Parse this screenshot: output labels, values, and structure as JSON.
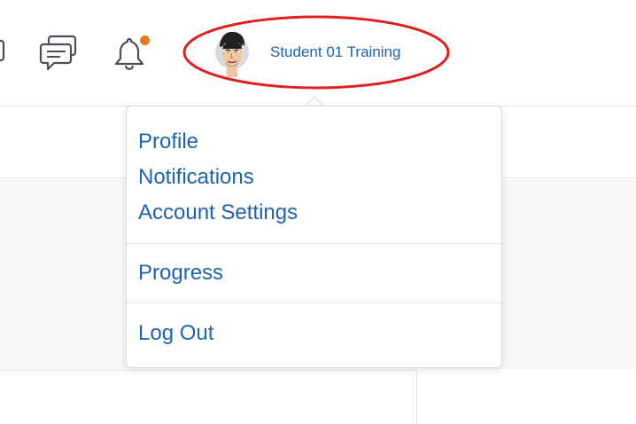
{
  "header": {
    "accent_color": "#2d6fb7",
    "icons": [
      "partial-icon",
      "chat-icon",
      "bell-icon"
    ],
    "notification_dot_color": "#e87722"
  },
  "user": {
    "name": "Student 01 Training",
    "avatar": "cartoon-face-avatar",
    "highlight_color": "#e02020"
  },
  "user_menu": {
    "items": [
      {
        "label": "Profile"
      },
      {
        "label": "Notifications"
      },
      {
        "label": "Account Settings"
      },
      {
        "label": "Progress"
      },
      {
        "label": "Log Out"
      }
    ],
    "link_color": "#1e63b0"
  }
}
